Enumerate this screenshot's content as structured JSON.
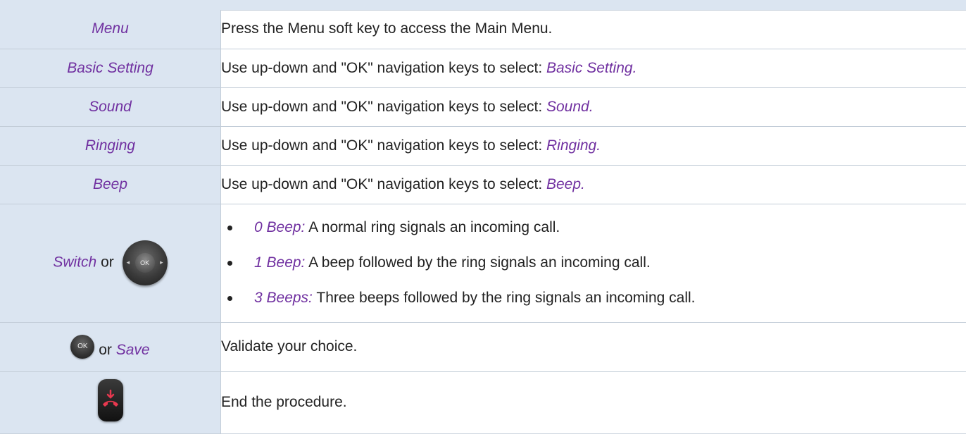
{
  "rows": [
    {
      "key": "Menu",
      "text": "Press the Menu soft key to access the Main Menu."
    },
    {
      "key": "Basic Setting",
      "text": "Use up-down and \"OK\" navigation keys to select: ",
      "highlight": "Basic Setting."
    },
    {
      "key": "Sound",
      "text": "Use up-down and \"OK\" navigation keys to select: ",
      "highlight": "Sound."
    },
    {
      "key": "Ringing",
      "text": "Use up-down and \"OK\" navigation keys to select: ",
      "highlight": "Ringing."
    },
    {
      "key": "Beep",
      "text": "Use up-down and \"OK\" navigation keys to select: ",
      "highlight": "Beep."
    }
  ],
  "switch_row": {
    "key": "Switch",
    "or": "or",
    "pad_ok_label": "OK",
    "options": [
      {
        "label": "0 Beep:",
        "text": " A normal ring signals an incoming call."
      },
      {
        "label": "1 Beep:",
        "text": " A beep followed by the ring signals an incoming call."
      },
      {
        "label": "3 Beeps:",
        "text": " Three beeps followed by the ring signals an incoming call."
      }
    ]
  },
  "save_row": {
    "ok_label": "OK",
    "or": "or",
    "key": "Save",
    "text": "Validate your choice."
  },
  "end_row": {
    "icon": "hang-up-icon",
    "text": "End the procedure."
  },
  "colors": {
    "key_bg": "#dbe5f1",
    "accent": "#7030a0",
    "hangup_red": "#e8384f"
  }
}
